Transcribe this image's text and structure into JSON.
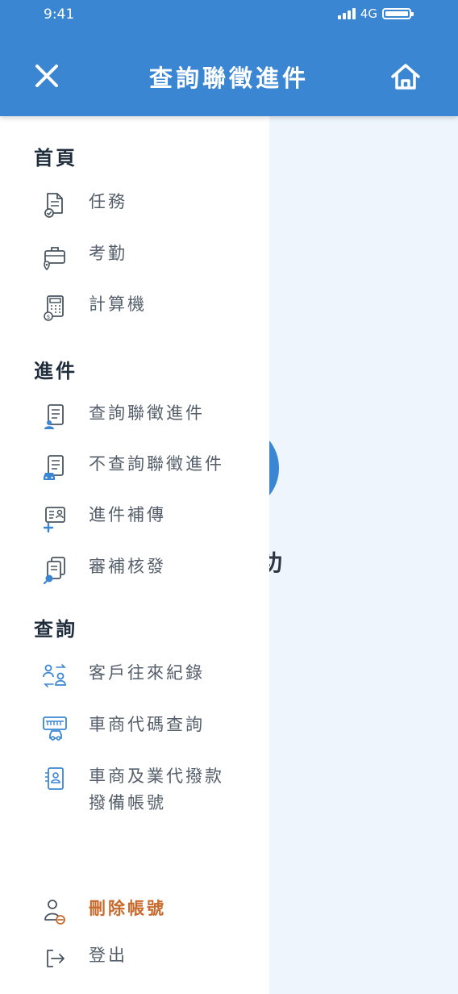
{
  "status_bar": {
    "time": "9:41",
    "network": "4G"
  },
  "header": {
    "title": "查詢聯徵進件",
    "close_icon": "close-icon",
    "home_icon": "home-icon"
  },
  "background": {
    "partial_text": "功"
  },
  "colors": {
    "primary": "#3a86d3",
    "danger": "#c76a2c",
    "text": "#555f6b",
    "heading": "#1f2d3d"
  },
  "menu": {
    "sections": [
      {
        "title": "首頁",
        "items": [
          {
            "label": "任務",
            "icon": "task-document-icon"
          },
          {
            "label": "考勤",
            "icon": "briefcase-location-icon"
          },
          {
            "label": "計算機",
            "icon": "calculator-icon"
          }
        ]
      },
      {
        "title": "進件",
        "items": [
          {
            "label": "查詢聯徵進件",
            "icon": "doc-person-icon"
          },
          {
            "label": "不查詢聯徵進件",
            "icon": "doc-car-icon"
          },
          {
            "label": "進件補傳",
            "icon": "id-card-plus-icon"
          },
          {
            "label": "審補核發",
            "icon": "docs-search-icon"
          }
        ]
      },
      {
        "title": "查詢",
        "items": [
          {
            "label": "客戶往來紀錄",
            "icon": "customers-exchange-icon"
          },
          {
            "label": "車商代碼查詢",
            "icon": "dealer-car-icon"
          },
          {
            "label_line1": "車商及業代撥款",
            "label_line2": "撥備帳號",
            "icon": "contact-card-icon"
          }
        ]
      }
    ],
    "footer": [
      {
        "label": "刪除帳號",
        "icon": "user-remove-icon"
      },
      {
        "label": "登出",
        "icon": "logout-icon"
      }
    ]
  }
}
